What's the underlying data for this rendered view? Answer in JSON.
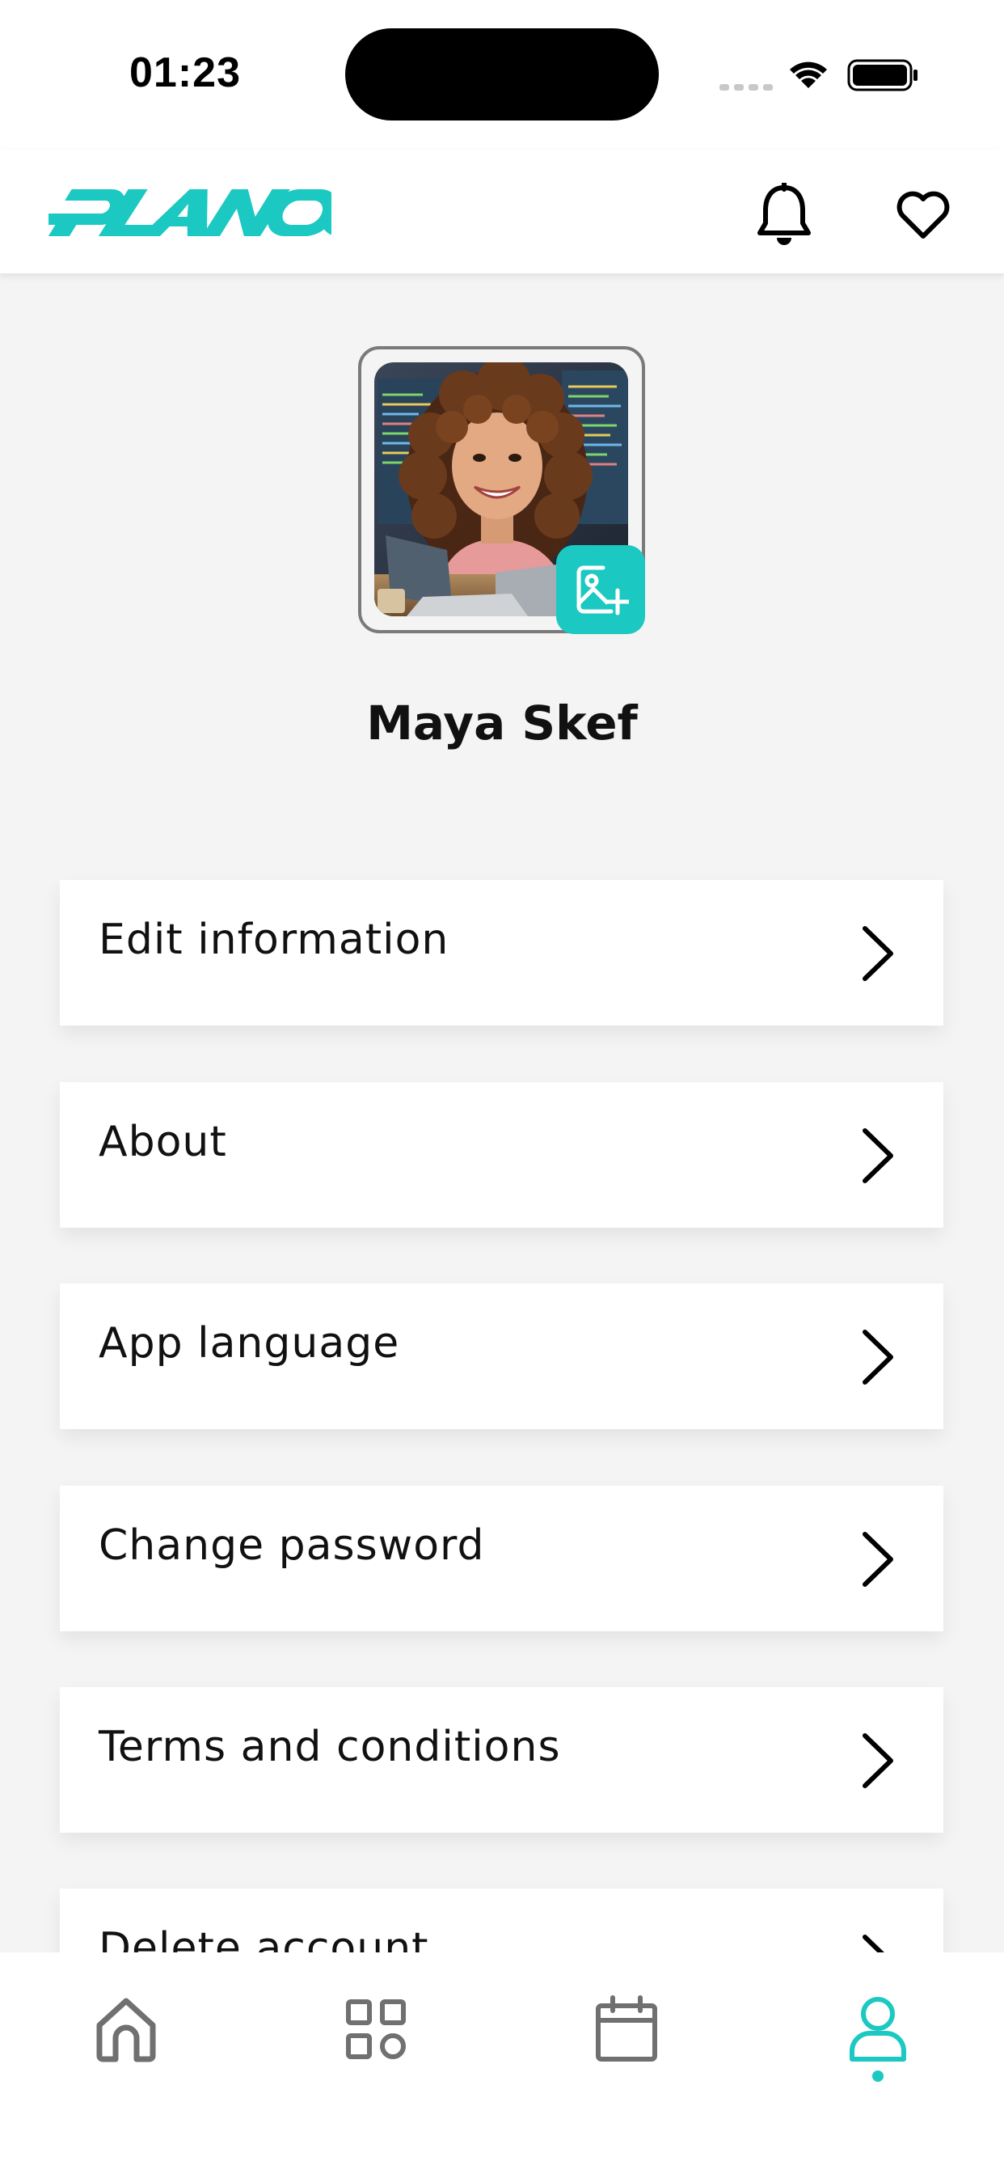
{
  "status_bar": {
    "time": "01:23"
  },
  "header": {
    "logo_text": "PLANOO",
    "brand_color": "#1cc8c2",
    "icons": [
      "bell-icon",
      "heart-icon"
    ]
  },
  "profile": {
    "name": "Maya Skef",
    "edit_photo_icon": "image-plus-icon"
  },
  "menu": {
    "items": [
      {
        "label": "Edit information"
      },
      {
        "label": "About"
      },
      {
        "label": "App language"
      },
      {
        "label": "Change password"
      },
      {
        "label": "Terms and conditions"
      },
      {
        "label": "Delete account"
      }
    ]
  },
  "bottom_nav": {
    "items": [
      "home-icon",
      "grid-icon",
      "calendar-icon",
      "profile-icon"
    ],
    "active": "profile-icon",
    "active_color": "#1cc8c2",
    "inactive_color": "#707070"
  }
}
